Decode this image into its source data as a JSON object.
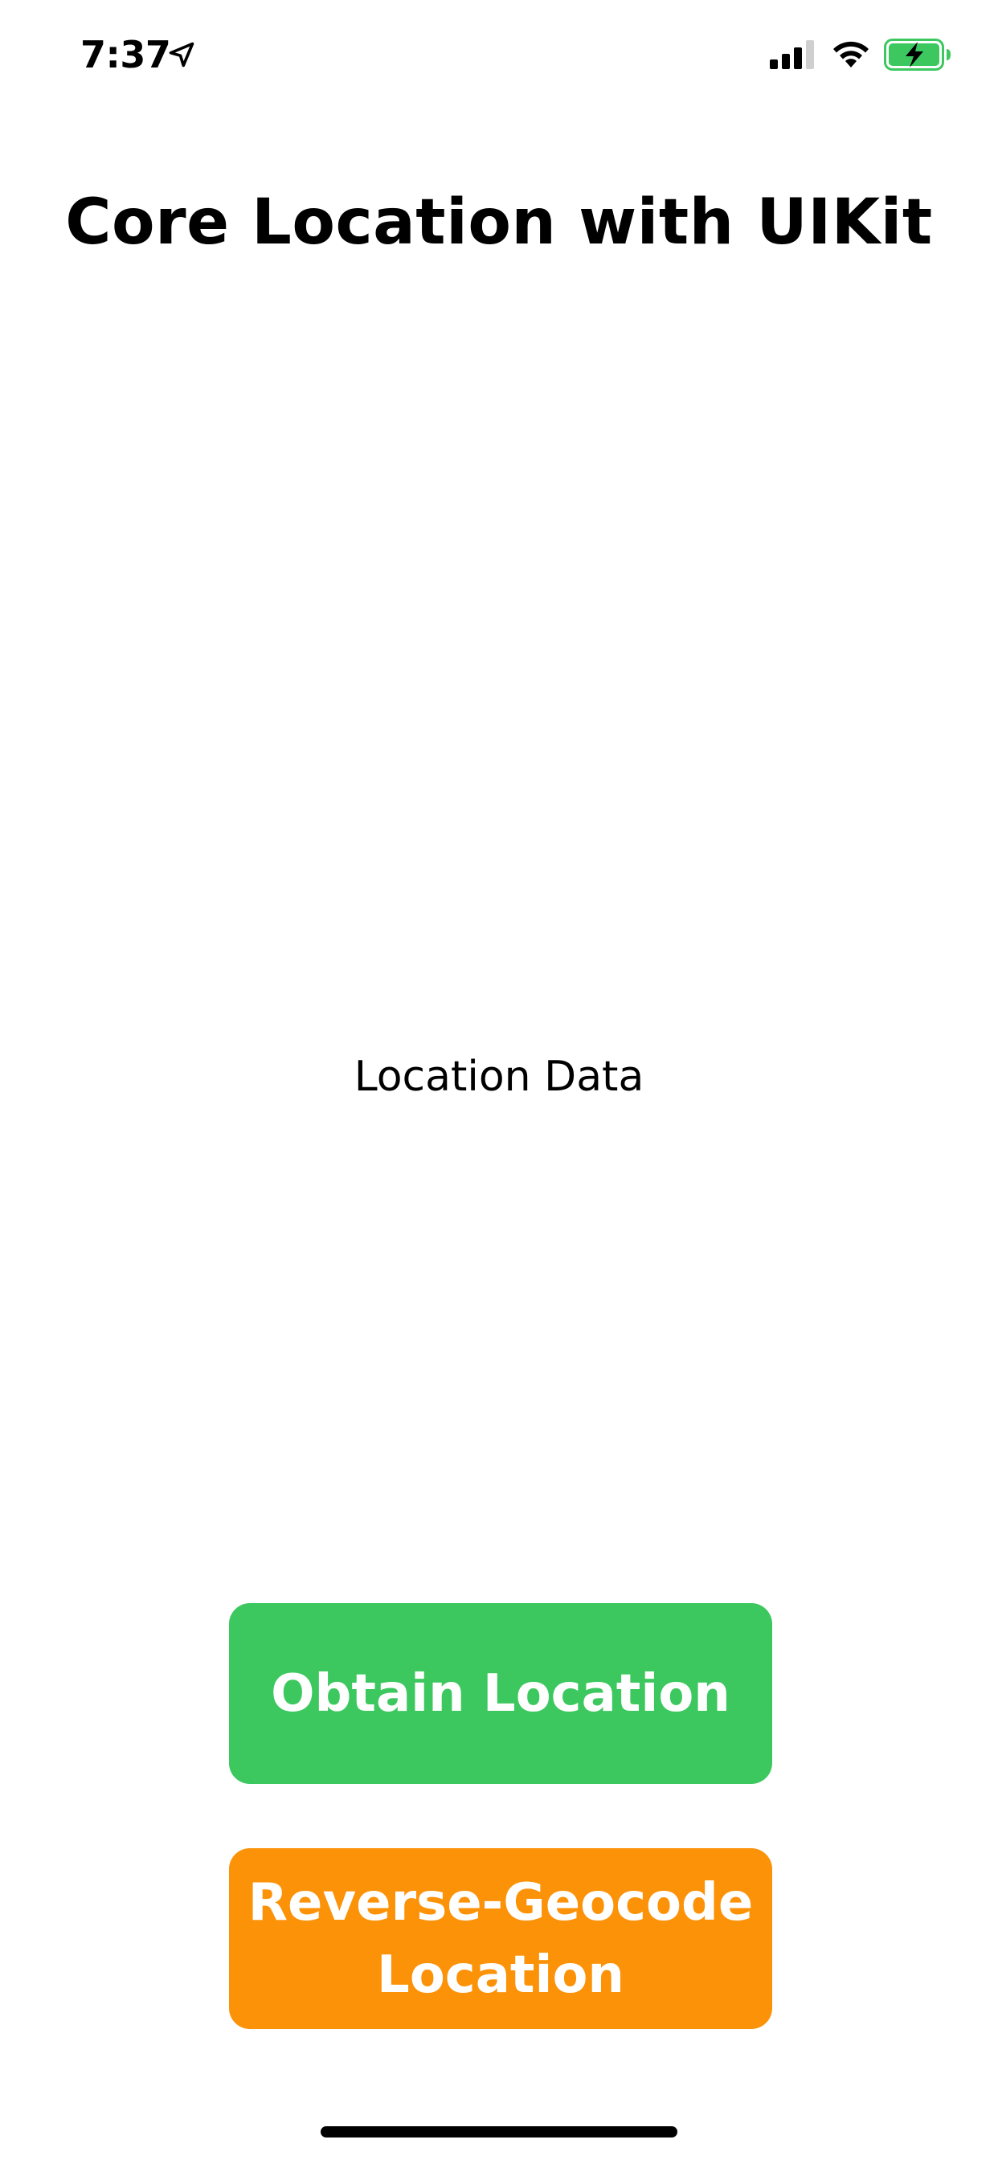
{
  "status_bar": {
    "time": "7:37",
    "icons": [
      "location-arrow-icon",
      "cellular-signal-icon",
      "wifi-icon",
      "battery-charging-icon"
    ],
    "battery_color": "#3CC85E"
  },
  "header": {
    "title": "Core Location with UIKit"
  },
  "main": {
    "location_label": "Location Data"
  },
  "actions": {
    "obtain_label": "Obtain Location",
    "obtain_color": "#3CC85E",
    "reverse_label": "Reverse-Geocode\nLocation",
    "reverse_color": "#FB9208"
  }
}
